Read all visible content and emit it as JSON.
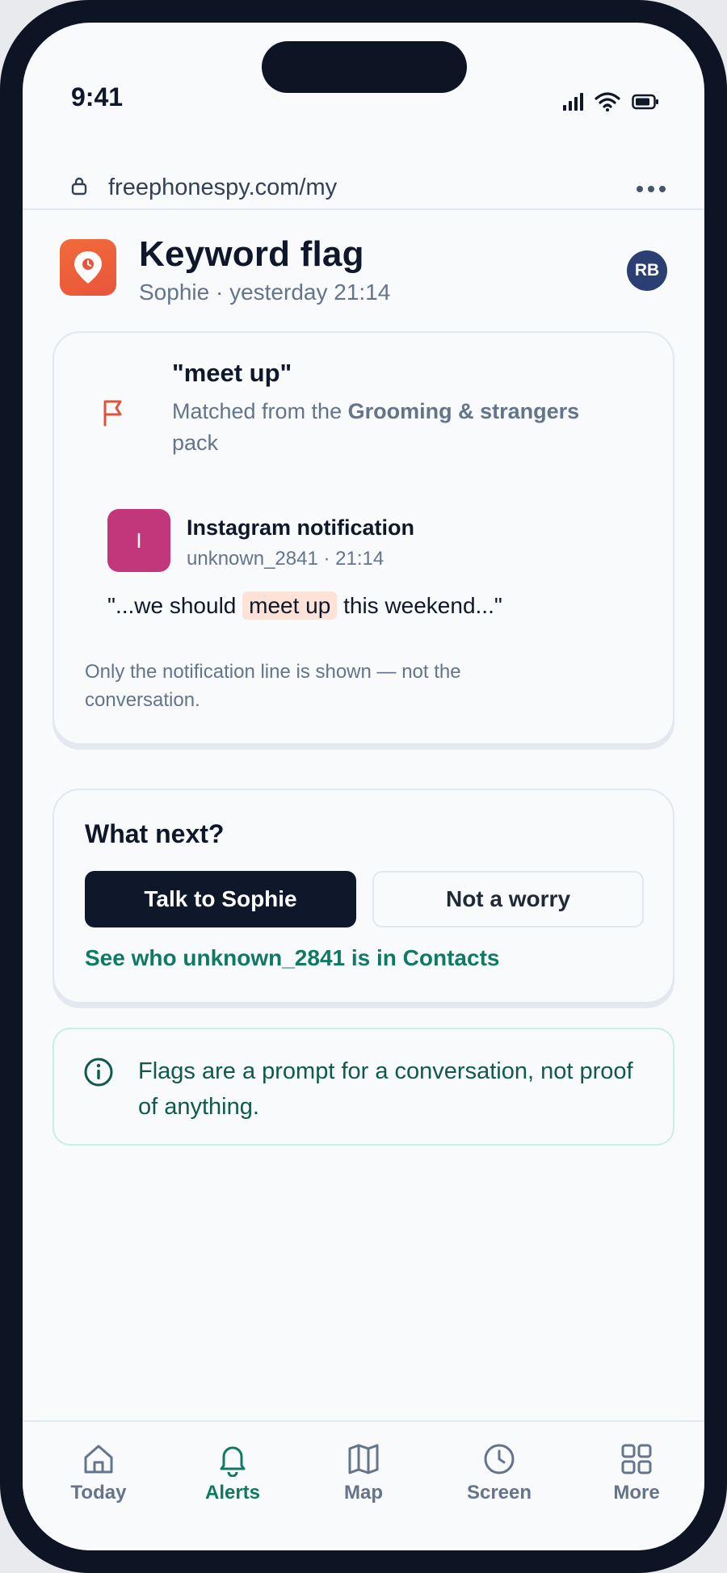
{
  "status_bar": {
    "time": "9:41"
  },
  "browser": {
    "url": "freephonespy.com/my"
  },
  "header": {
    "title": "Keyword flag",
    "subtitle": "Sophie · yesterday 21:14",
    "avatar_initials": "RB"
  },
  "flag_card": {
    "keyword": "\"meet up\"",
    "match_prefix": "Matched from the ",
    "match_pack": "Grooming & strangers",
    "match_suffix": " pack",
    "notification": {
      "app_initial": "I",
      "title": "Instagram notification",
      "meta": "unknown_2841 · 21:14",
      "quote_before": "\"...we should ",
      "quote_highlight": "meet up",
      "quote_after": " this weekend...\""
    },
    "disclaimer": "Only the notification line is shown — not the conversation."
  },
  "next_card": {
    "title": "What next?",
    "primary_button": "Talk to Sophie",
    "secondary_button": "Not a worry",
    "contacts_link": "See who unknown_2841 is in Contacts"
  },
  "info": {
    "text": "Flags are a prompt for a conversation, not proof of anything."
  },
  "nav": {
    "items": [
      {
        "label": "Today",
        "icon": "home-icon"
      },
      {
        "label": "Alerts",
        "icon": "bell-icon",
        "active": true
      },
      {
        "label": "Map",
        "icon": "map-icon"
      },
      {
        "label": "Screen",
        "icon": "clock-icon"
      },
      {
        "label": "More",
        "icon": "grid-icon"
      }
    ]
  },
  "colors": {
    "accent": "#0f7a63",
    "brand_orange": "#f26b3a",
    "instagram": "#c2367c",
    "highlight": "#fde2d8",
    "dark": "#0f172a"
  }
}
